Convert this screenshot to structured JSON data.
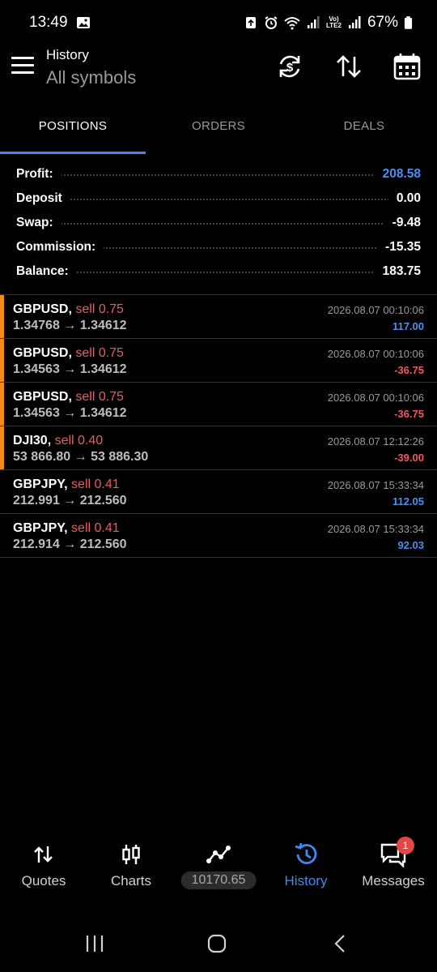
{
  "status": {
    "time": "13:49",
    "battery": "67%",
    "network_label": "LTE2"
  },
  "header": {
    "title": "History",
    "subtitle": "All symbols"
  },
  "tabs": [
    {
      "label": "POSITIONS",
      "active": true
    },
    {
      "label": "ORDERS",
      "active": false
    },
    {
      "label": "DEALS",
      "active": false
    }
  ],
  "summary": {
    "profit_label": "Profit:",
    "profit": "208.58",
    "deposit_label": "Deposit",
    "deposit": "0.00",
    "swap_label": "Swap:",
    "swap": "-9.48",
    "commission_label": "Commission:",
    "commission": "-15.35",
    "balance_label": "Balance:",
    "balance": "183.75"
  },
  "positions": [
    {
      "symbol": "GBPUSD,",
      "side": "sell 0.75",
      "prices": "1.34768 → 1.34612",
      "date": "2026.08.07 00:10:06",
      "pl": "117.00",
      "sign": "pos",
      "marked": true
    },
    {
      "symbol": "GBPUSD,",
      "side": "sell 0.75",
      "prices": "1.34563 → 1.34612",
      "date": "2026.08.07 00:10:06",
      "pl": "-36.75",
      "sign": "neg",
      "marked": true
    },
    {
      "symbol": "GBPUSD,",
      "side": "sell 0.75",
      "prices": "1.34563 → 1.34612",
      "date": "2026.08.07 00:10:06",
      "pl": "-36.75",
      "sign": "neg",
      "marked": true
    },
    {
      "symbol": "DJI30,",
      "side": "sell 0.40",
      "prices": "53 866.80 → 53 886.30",
      "date": "2026.08.07 12:12:26",
      "pl": "-39.00",
      "sign": "neg",
      "marked": true
    },
    {
      "symbol": "GBPJPY,",
      "side": "sell 0.41",
      "prices": "212.991 → 212.560",
      "date": "2026.08.07 15:33:34",
      "pl": "112.05",
      "sign": "pos",
      "marked": false
    },
    {
      "symbol": "GBPJPY,",
      "side": "sell 0.41",
      "prices": "212.914 → 212.560",
      "date": "2026.08.07 15:33:34",
      "pl": "92.03",
      "sign": "pos",
      "marked": false
    }
  ],
  "bottom_nav": {
    "quotes": "Quotes",
    "charts": "Charts",
    "trade_balance": "10170.65",
    "history": "History",
    "messages": "Messages",
    "messages_badge": "1"
  },
  "colors": {
    "accent": "#3d8bf2",
    "profit_positive": "#4d8ff0",
    "profit_negative": "#f05a5a",
    "position_marker": "#f28b1e"
  },
  "icons": {
    "menu": "menu-icon",
    "currency_refresh": "currency-refresh-icon",
    "sort": "sort-icon",
    "calendar": "calendar-icon"
  }
}
